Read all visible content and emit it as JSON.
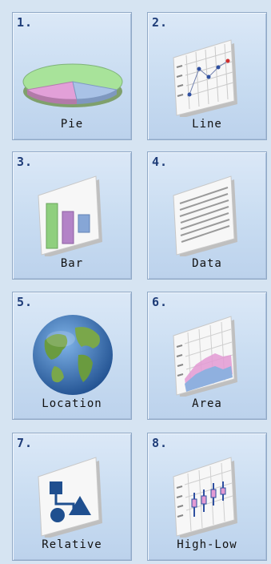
{
  "tiles": [
    {
      "num": "1.",
      "label": "Pie",
      "icon": "pie-chart-icon"
    },
    {
      "num": "2.",
      "label": "Line",
      "icon": "line-chart-icon"
    },
    {
      "num": "3.",
      "label": "Bar",
      "icon": "bar-chart-icon"
    },
    {
      "num": "4.",
      "label": "Data",
      "icon": "data-table-icon"
    },
    {
      "num": "5.",
      "label": "Location",
      "icon": "globe-icon"
    },
    {
      "num": "6.",
      "label": "Area",
      "icon": "area-chart-icon"
    },
    {
      "num": "7.",
      "label": "Relative",
      "icon": "relationship-diagram-icon"
    },
    {
      "num": "8.",
      "label": "High-Low",
      "icon": "high-low-chart-icon"
    }
  ],
  "colors": {
    "pie_green": "#a8e39a",
    "pie_pink": "#e2a0d8",
    "pie_blue": "#a9c2e6",
    "bar_green": "#8fcf7e",
    "bar_purple": "#b383c7",
    "bar_blue": "#86a6d6",
    "area_pink": "#e39ad3",
    "area_blue": "#8fb0df",
    "globe_ocean": "#2f6eb3",
    "globe_land": "#6a9b3f"
  }
}
